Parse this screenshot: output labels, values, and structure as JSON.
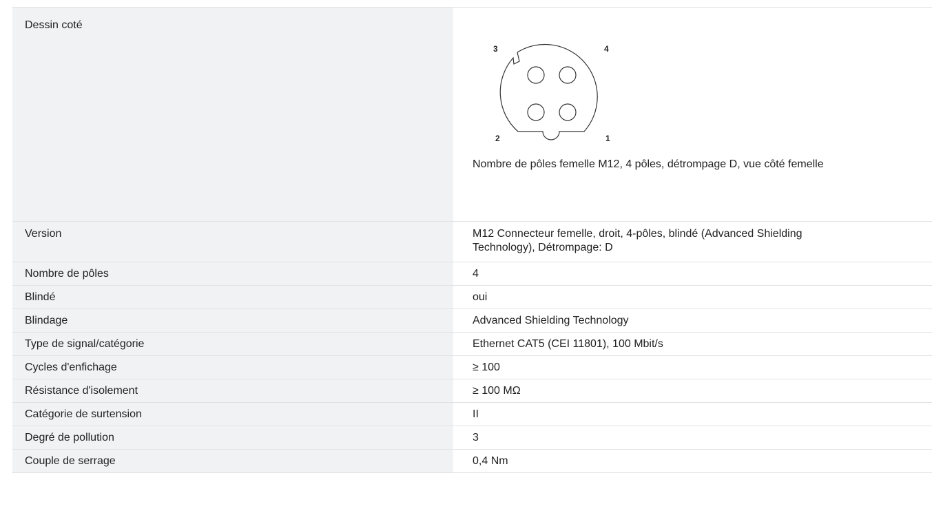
{
  "drawing": {
    "label": "Dessin coté",
    "pins": [
      "3",
      "4",
      "2",
      "1"
    ],
    "caption": "Nombre de pôles femelle M12, 4 pôles, détrompage D, vue côté femelle"
  },
  "rows": [
    {
      "label": "Version",
      "value": "M12 Connecteur femelle, droit, 4-pôles, blindé (Advanced Shielding Technology), Détrompage: D"
    },
    {
      "label": "Nombre de pôles",
      "value": "4"
    },
    {
      "label": "Blindé",
      "value": "oui"
    },
    {
      "label": "Blindage",
      "value": "Advanced Shielding Technology"
    },
    {
      "label": "Type de signal/catégorie",
      "value": "Ethernet CAT5 (CEI 11801), 100 Mbit/s"
    },
    {
      "label": "Cycles d'enfichage",
      "value": "≥ 100"
    },
    {
      "label": "Résistance d'isolement",
      "value": "≥ 100 MΩ"
    },
    {
      "label": "Catégorie de surtension",
      "value": "II"
    },
    {
      "label": "Degré de pollution",
      "value": "3"
    },
    {
      "label": "Couple de serrage",
      "value": "0,4 Nm"
    }
  ]
}
